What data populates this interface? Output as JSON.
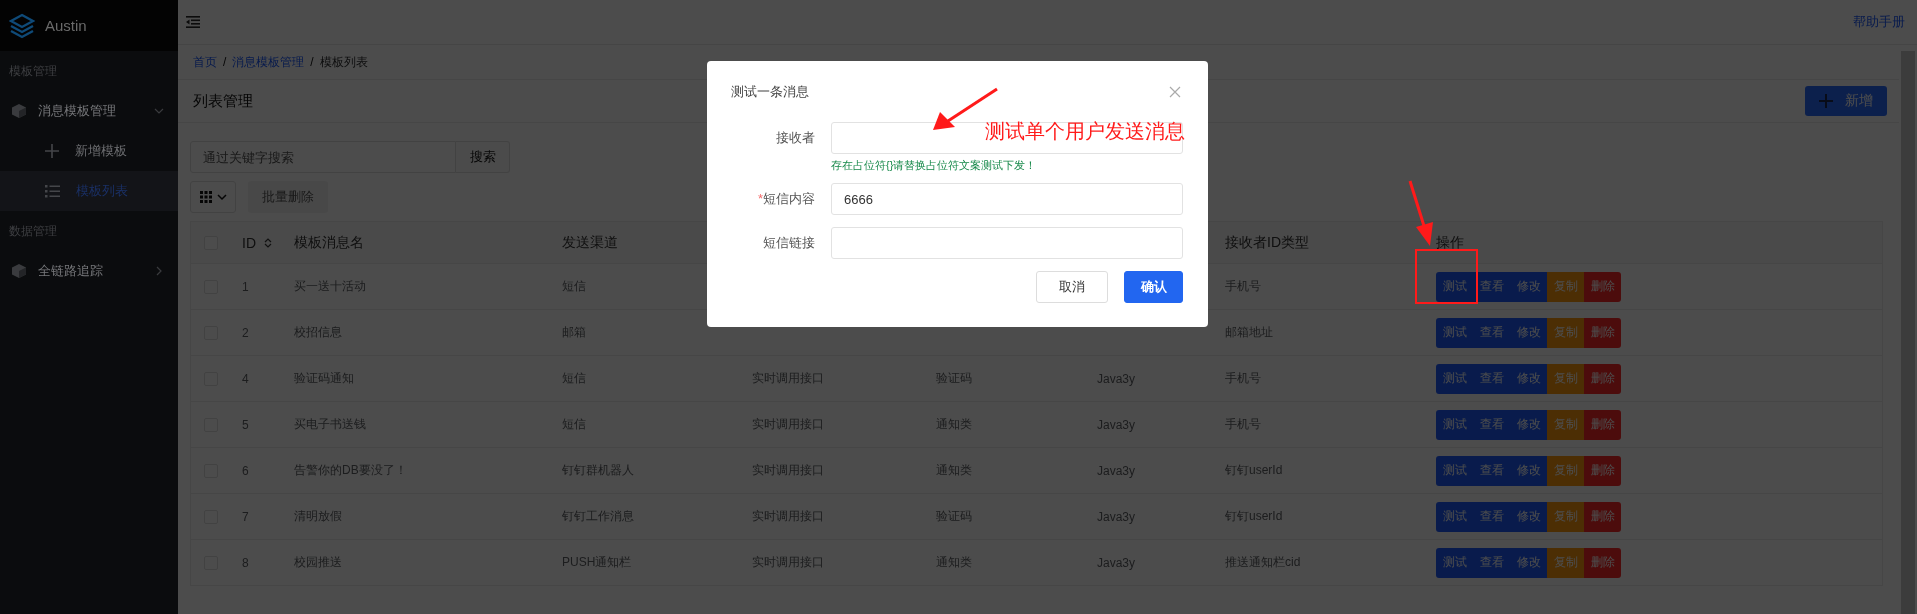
{
  "sidebar": {
    "brand": "Austin",
    "groups": [
      {
        "title": "模板管理",
        "items": [
          {
            "label": "消息模板管理",
            "expanded": true,
            "children": [
              {
                "label": "新增模板",
                "kind": "add",
                "selected": false
              },
              {
                "label": "模板列表",
                "kind": "list",
                "selected": true
              }
            ]
          }
        ]
      },
      {
        "title": "数据管理",
        "items": [
          {
            "label": "全链路追踪",
            "expanded": false
          }
        ]
      }
    ]
  },
  "header": {
    "help_link": "帮助手册"
  },
  "breadcrumb": [
    {
      "label": "首页"
    },
    {
      "separator": "/",
      "label": "消息模板管理"
    },
    {
      "separator": "/",
      "label": "模板列表"
    }
  ],
  "page_title": "列表管理",
  "add_button": "新增",
  "search": {
    "placeholder": "通过关键字搜索",
    "button": "搜索"
  },
  "toolbar": {
    "batch_delete": {
      "label": "批量删除",
      "disabled": true
    }
  },
  "table": {
    "select_all": {
      "checked": false
    },
    "columns": [
      {
        "label": "ID",
        "sortable": true
      },
      {
        "label": "模板消息名"
      },
      {
        "label": "发送渠道"
      },
      null,
      null,
      null,
      {
        "label": "接收者ID类型"
      },
      {
        "label": "操作"
      }
    ],
    "rows": [
      {
        "checked": false,
        "cells": [
          "1",
          "买一送十活动",
          "短信",
          null,
          null,
          null,
          "手机号"
        ],
        "actions": [
          {
            "label": "测试",
            "kind": "primary"
          },
          {
            "label": "查看",
            "kind": "primary"
          },
          {
            "label": "修改",
            "kind": "primary"
          },
          {
            "label": "复制",
            "kind": "warning"
          },
          {
            "label": "删除",
            "kind": "danger"
          }
        ]
      },
      {
        "checked": false,
        "cells": [
          "2",
          "校招信息",
          "邮箱",
          null,
          null,
          null,
          "邮箱地址"
        ],
        "actions": [
          {
            "label": "测试",
            "kind": "primary"
          },
          {
            "label": "查看",
            "kind": "primary"
          },
          {
            "label": "修改",
            "kind": "primary"
          },
          {
            "label": "复制",
            "kind": "warning"
          },
          {
            "label": "删除",
            "kind": "danger"
          }
        ]
      },
      {
        "checked": false,
        "cells": [
          "4",
          "验证码通知",
          "短信",
          "实时调用接口",
          "验证码",
          "Java3y",
          "手机号"
        ],
        "actions": [
          {
            "label": "测试",
            "kind": "primary"
          },
          {
            "label": "查看",
            "kind": "primary"
          },
          {
            "label": "修改",
            "kind": "primary"
          },
          {
            "label": "复制",
            "kind": "warning"
          },
          {
            "label": "删除",
            "kind": "danger"
          }
        ]
      },
      {
        "checked": false,
        "cells": [
          "5",
          "买电子书送钱",
          "短信",
          "实时调用接口",
          "通知类",
          "Java3y",
          "手机号"
        ],
        "actions": [
          {
            "label": "测试",
            "kind": "primary"
          },
          {
            "label": "查看",
            "kind": "primary"
          },
          {
            "label": "修改",
            "kind": "primary"
          },
          {
            "label": "复制",
            "kind": "warning"
          },
          {
            "label": "删除",
            "kind": "danger"
          }
        ]
      },
      {
        "checked": false,
        "cells": [
          "6",
          "告警你的DB要没了！",
          "钉钉群机器人",
          "实时调用接口",
          "通知类",
          "Java3y",
          "钉钉userId"
        ],
        "actions": [
          {
            "label": "测试",
            "kind": "primary"
          },
          {
            "label": "查看",
            "kind": "primary"
          },
          {
            "label": "修改",
            "kind": "primary"
          },
          {
            "label": "复制",
            "kind": "warning"
          },
          {
            "label": "删除",
            "kind": "danger"
          }
        ]
      },
      {
        "checked": false,
        "cells": [
          "7",
          "清明放假",
          "钉钉工作消息",
          "实时调用接口",
          "验证码",
          "Java3y",
          "钉钉userId"
        ],
        "actions": [
          {
            "label": "测试",
            "kind": "primary"
          },
          {
            "label": "查看",
            "kind": "primary"
          },
          {
            "label": "修改",
            "kind": "primary"
          },
          {
            "label": "复制",
            "kind": "warning"
          },
          {
            "label": "删除",
            "kind": "danger"
          }
        ]
      },
      {
        "checked": false,
        "cells": [
          "8",
          "校园推送",
          "PUSH通知栏",
          "实时调用接口",
          "通知类",
          "Java3y",
          "推送通知栏cid"
        ],
        "actions": [
          {
            "label": "测试",
            "kind": "primary"
          },
          {
            "label": "查看",
            "kind": "primary"
          },
          {
            "label": "修改",
            "kind": "primary"
          },
          {
            "label": "复制",
            "kind": "warning"
          },
          {
            "label": "删除",
            "kind": "danger"
          }
        ]
      }
    ]
  },
  "modal": {
    "title": "测试一条消息",
    "fields": [
      {
        "label": "接收者",
        "hint": "存在占位符{}请替换占位符文案测试下发！"
      },
      {
        "required_mark": "*",
        "label": "短信内容",
        "value": "6666"
      },
      {
        "label": "短信链接"
      }
    ],
    "buttons": [
      {
        "label": "取消",
        "kind": "default"
      },
      {
        "label": "确认",
        "kind": "primary"
      }
    ]
  },
  "annotation": {
    "text": "测试单个用户发送消息"
  }
}
